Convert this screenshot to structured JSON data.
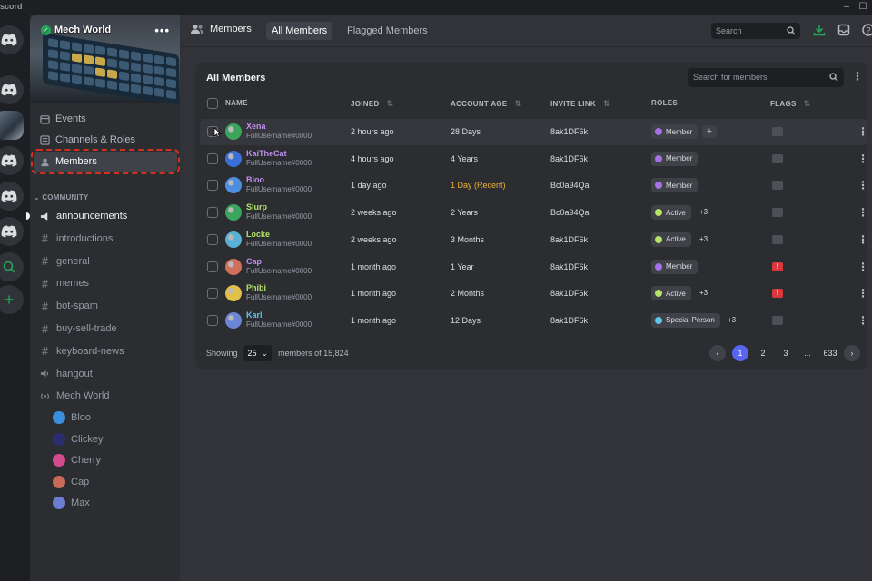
{
  "window": {
    "app_name": "scord"
  },
  "server_rail": {
    "items": [
      {
        "name": "home",
        "icon": "discord-icon"
      },
      {
        "name": "server-1",
        "icon": "discord-icon"
      },
      {
        "name": "mech-world",
        "icon": "server-image"
      },
      {
        "name": "server-3",
        "icon": "discord-icon"
      },
      {
        "name": "server-4",
        "icon": "discord-icon"
      },
      {
        "name": "server-5",
        "icon": "discord-icon"
      },
      {
        "name": "explore",
        "icon": "compass-icon"
      },
      {
        "name": "add-server",
        "icon": "plus-icon"
      }
    ]
  },
  "sidebar": {
    "server_name": "Mech World",
    "nav": [
      {
        "label": "Events",
        "icon": "calendar-icon"
      },
      {
        "label": "Channels & Roles",
        "icon": "list-icon"
      },
      {
        "label": "Members",
        "icon": "members-icon",
        "active": true
      }
    ],
    "category": "COMMUNITY",
    "channels": [
      {
        "label": "announcements",
        "icon": "megaphone-icon",
        "unread": true
      },
      {
        "label": "introductions",
        "icon": "hash-icon"
      },
      {
        "label": "general",
        "icon": "hash-icon"
      },
      {
        "label": "memes",
        "icon": "hash-icon"
      },
      {
        "label": "bot-spam",
        "icon": "hash-icon"
      },
      {
        "label": "buy-sell-trade",
        "icon": "hash-icon"
      },
      {
        "label": "keyboard-news",
        "icon": "hash-icon"
      },
      {
        "label": "hangout",
        "icon": "speaker-icon"
      },
      {
        "label": "Mech World",
        "icon": "stage-icon"
      }
    ],
    "voice_users": [
      {
        "name": "Bloo",
        "color": "#3c8dde"
      },
      {
        "name": "Clickey",
        "color": "#2a2d6e"
      },
      {
        "name": "Cherry",
        "color": "#d34b8f"
      },
      {
        "name": "Cap",
        "color": "#c9695a"
      },
      {
        "name": "Max",
        "color": "#6a7fd1"
      }
    ]
  },
  "header": {
    "title": "Members",
    "tabs": [
      {
        "label": "All Members",
        "active": true
      },
      {
        "label": "Flagged Members",
        "active": false
      }
    ],
    "search_placeholder": "Search"
  },
  "panel": {
    "title": "All Members",
    "search_placeholder": "Search for members",
    "columns": [
      "NAME",
      "JOINED",
      "ACCOUNT AGE",
      "INVITE LINK",
      "ROLES",
      "FLAGS"
    ],
    "rows": [
      {
        "name": "Xena",
        "handle": "FullUsername#0000",
        "name_color": "#c18ff0",
        "avatar": "#3ba55c",
        "joined": "2 hours ago",
        "age": "28 Days",
        "age_recent": false,
        "invite": "8ak1DF6k",
        "role": "Member",
        "role_color": "#a571e6",
        "extra": "",
        "add_role": true,
        "flagged": false
      },
      {
        "name": "KaiTheCat",
        "handle": "FullUsername#0000",
        "name_color": "#c18ff0",
        "avatar": "#3a6fd8",
        "joined": "4 hours ago",
        "age": "4 Years",
        "age_recent": false,
        "invite": "8ak1DF6k",
        "role": "Member",
        "role_color": "#a571e6",
        "extra": "",
        "add_role": false,
        "flagged": false
      },
      {
        "name": "Bloo",
        "handle": "FullUsername#0000",
        "name_color": "#c18ff0",
        "avatar": "#4d8ee0",
        "joined": "1 day ago",
        "age": "1 Day (Recent)",
        "age_recent": true,
        "invite": "Bc0a94Qa",
        "role": "Member",
        "role_color": "#a571e6",
        "extra": "",
        "add_role": false,
        "flagged": false
      },
      {
        "name": "Slurp",
        "handle": "FullUsername#0000",
        "name_color": "#b6e36b",
        "avatar": "#3aa55d",
        "joined": "2 weeks ago",
        "age": "2 Years",
        "age_recent": false,
        "invite": "Bc0a94Qa",
        "role": "Active",
        "role_color": "#b6e36b",
        "extra": "+3",
        "add_role": false,
        "flagged": false
      },
      {
        "name": "Locke",
        "handle": "FullUsername#0000",
        "name_color": "#b6e36b",
        "avatar": "#5bb0d6",
        "joined": "2 weeks ago",
        "age": "3 Months",
        "age_recent": false,
        "invite": "8ak1DF6k",
        "role": "Active",
        "role_color": "#b6e36b",
        "extra": "+3",
        "add_role": false,
        "flagged": false
      },
      {
        "name": "Cap",
        "handle": "FullUsername#0000",
        "name_color": "#c18ff0",
        "avatar": "#d0705c",
        "joined": "1 month ago",
        "age": "1 Year",
        "age_recent": false,
        "invite": "8ak1DF6k",
        "role": "Member",
        "role_color": "#a571e6",
        "extra": "",
        "add_role": false,
        "flagged": true
      },
      {
        "name": "Phibi",
        "handle": "FullUsername#0000",
        "name_color": "#b6e36b",
        "avatar": "#e0c04a",
        "joined": "1 month ago",
        "age": "2 Months",
        "age_recent": false,
        "invite": "8ak1DF6k",
        "role": "Active",
        "role_color": "#b6e36b",
        "extra": "+3",
        "add_role": false,
        "flagged": true
      },
      {
        "name": "Karl",
        "handle": "FullUsername#0000",
        "name_color": "#5fc7e8",
        "avatar": "#6b86d6",
        "joined": "1 month ago",
        "age": "12 Days",
        "age_recent": false,
        "invite": "8ak1DF6k",
        "role": "Special Person",
        "role_color": "#5fc7e8",
        "extra": "+3",
        "add_role": false,
        "flagged": false
      }
    ],
    "footer": {
      "showing": "Showing",
      "page_size": "25",
      "members_of": "members of 15,824"
    },
    "pagination": {
      "pages": [
        "1",
        "2",
        "3",
        "...",
        "633"
      ],
      "current": "1"
    }
  },
  "colors": {
    "accent": "#5865f2",
    "danger": "#da373c",
    "highlight_dashed": "#d4301f",
    "recent": "#f0b232"
  }
}
